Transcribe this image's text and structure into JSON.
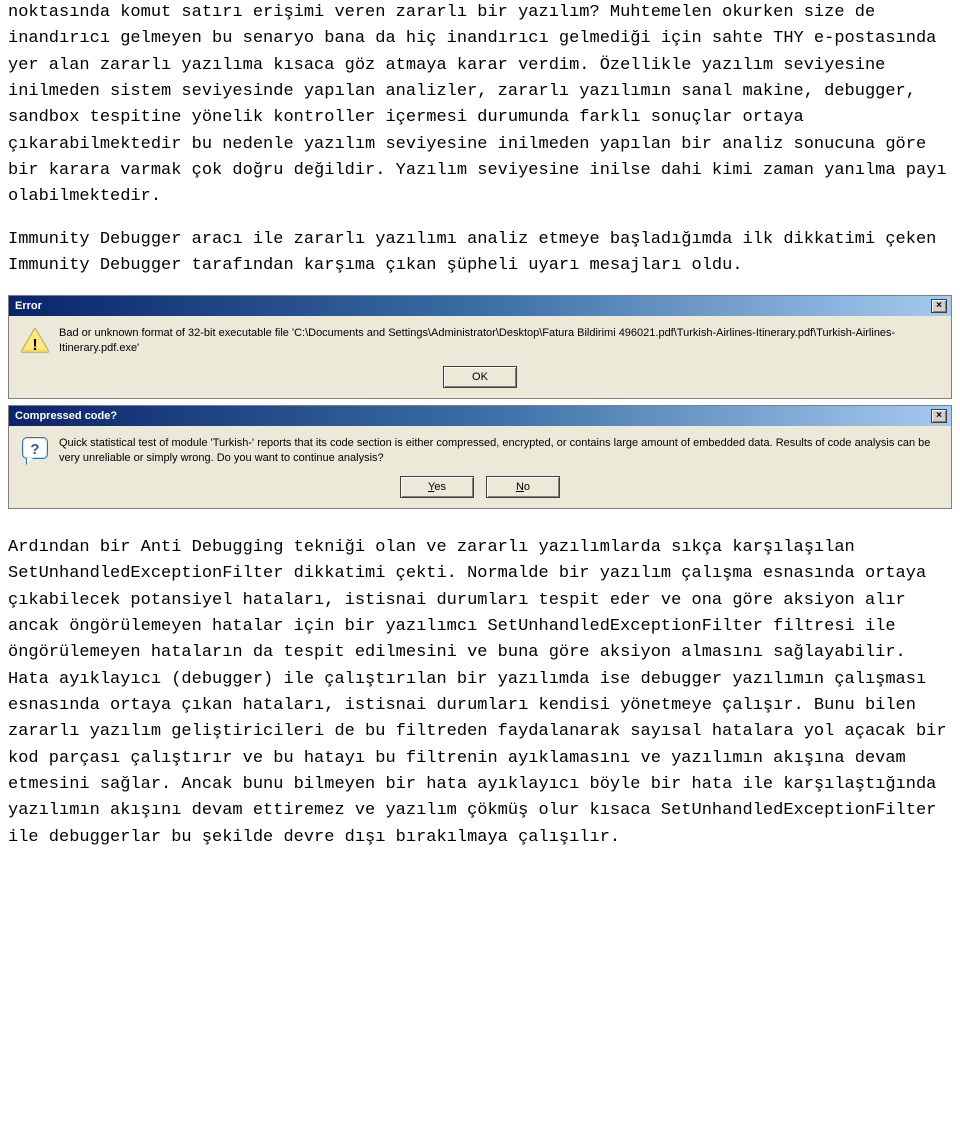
{
  "paragraphs": {
    "p1": "noktasında komut satırı erişimi veren zararlı bir yazılım? Muhtemelen okurken size de inandırıcı gelmeyen bu senaryo bana da hiç inandırıcı gelmediği için sahte THY e-postasında yer alan zararlı yazılıma kısaca göz atmaya karar verdim. Özellikle yazılım seviyesine inilmeden sistem seviyesinde yapılan analizler, zararlı yazılımın sanal makine, debugger, sandbox tespitine yönelik kontroller içermesi durumunda farklı sonuçlar ortaya çıkarabilmektedir bu nedenle yazılım seviyesine inilmeden yapılan bir analiz sonucuna göre bir karara varmak çok doğru değildir. Yazılım seviyesine inilse dahi kimi zaman yanılma payı olabilmektedir.",
    "p2": "Immunity Debugger aracı ile zararlı yazılımı analiz etmeye başladığımda ilk dikkatimi çeken Immunity Debugger tarafından karşıma çıkan şüpheli uyarı mesajları oldu.",
    "p3": "Ardından bir Anti Debugging tekniği olan ve zararlı yazılımlarda sıkça karşılaşılan SetUnhandledExceptionFilter dikkatimi çekti. Normalde bir yazılım çalışma esnasında ortaya çıkabilecek potansiyel hataları, istisnai durumları tespit eder ve ona göre aksiyon alır ancak öngörülemeyen hatalar için bir yazılımcı SetUnhandledExceptionFilter filtresi ile öngörülemeyen hataların da tespit edilmesini ve buna göre aksiyon almasını sağlayabilir. Hata ayıklayıcı (debugger) ile çalıştırılan bir yazılımda ise debugger yazılımın çalışması esnasında ortaya çıkan hataları, istisnai durumları kendisi yönetmeye çalışır. Bunu bilen zararlı yazılım geliştiricileri de bu filtreden faydalanarak sayısal hatalara yol açacak bir kod parçası çalıştırır ve bu hatayı bu filtrenin ayıklamasını ve yazılımın akışına devam etmesini sağlar. Ancak bunu bilmeyen bir hata ayıklayıcı böyle bir hata ile karşılaştığında yazılımın akışını devam ettiremez ve yazılım çökmüş olur kısaca SetUnhandledExceptionFilter ile debuggerlar bu şekilde devre dışı bırakılmaya çalışılır."
  },
  "dialog1": {
    "title": "Error",
    "message": "Bad or unknown format of 32-bit executable file 'C:\\Documents and Settings\\Administrator\\Desktop\\Fatura Bildirimi 496021.pdf\\Turkish-Airlines-Itinerary.pdf\\Turkish-Airlines-Itinerary.pdf.exe'",
    "ok": "OK",
    "close": "×"
  },
  "dialog2": {
    "title": "Compressed code?",
    "message": "Quick statistical test of module 'Turkish-' reports that its code section is either compressed, encrypted, or contains large amount of embedded data. Results of code analysis can be very unreliable or simply wrong. Do you want to continue analysis?",
    "yes_pre": "Y",
    "yes_rest": "es",
    "no_pre": "N",
    "no_rest": "o",
    "close": "×"
  }
}
